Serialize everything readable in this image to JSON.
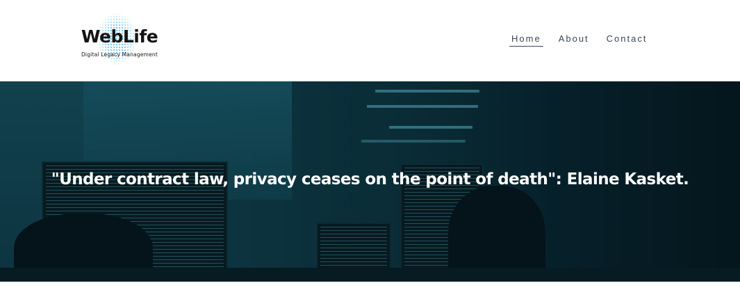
{
  "logo": {
    "title": "WebLife",
    "tagline": "Digital Legacy Management"
  },
  "nav": {
    "items": [
      {
        "label": "Home",
        "active": true
      },
      {
        "label": "About",
        "active": false
      },
      {
        "label": "Contact",
        "active": false
      }
    ]
  },
  "hero": {
    "quote": "\"Under contract law, privacy ceases on the point of death\": Elaine Kasket.",
    "image": "office-computer-screens-photo"
  },
  "colors": {
    "nav_text": "#3a4654",
    "hero_overlay": "#0c3440",
    "logo_dots": "#6fc9ea"
  }
}
